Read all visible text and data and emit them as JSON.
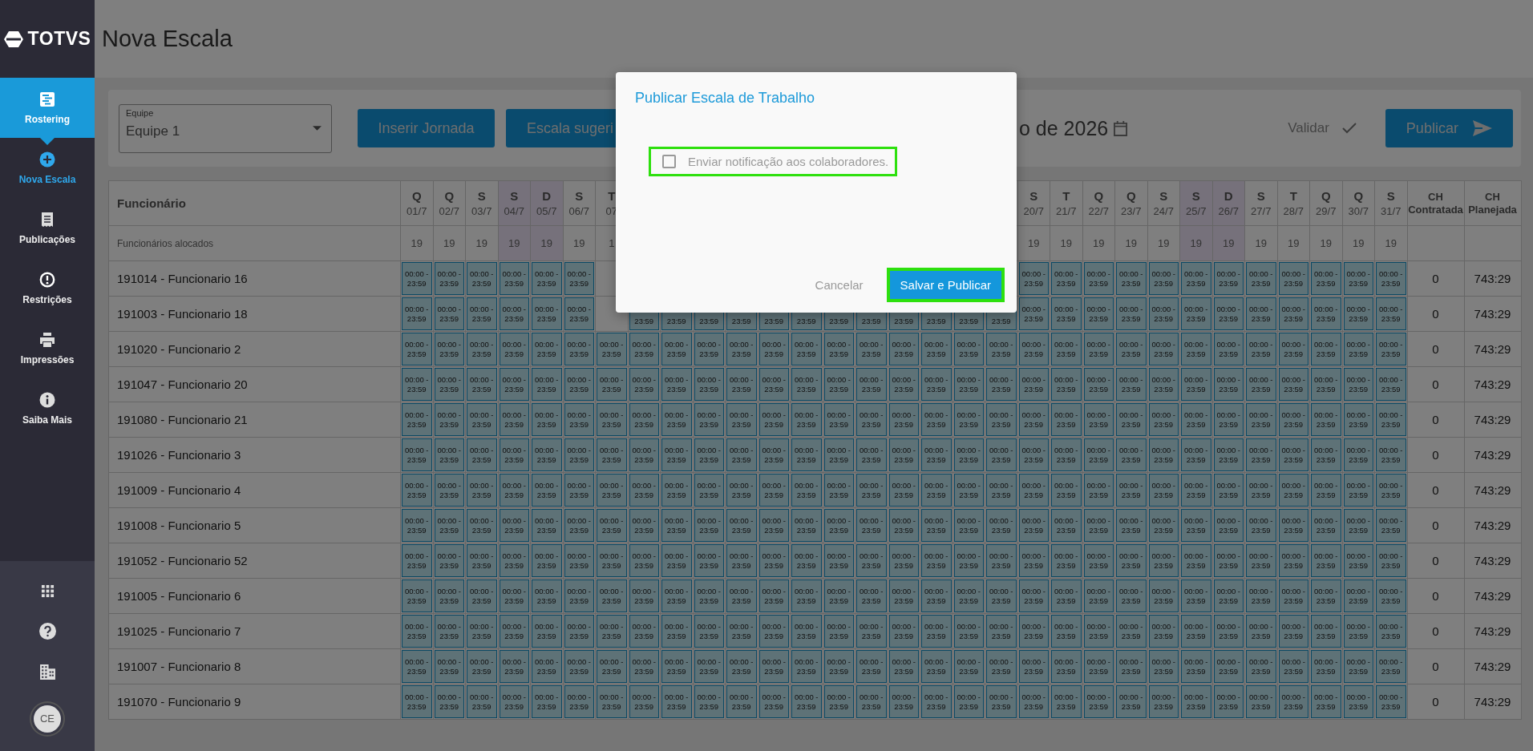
{
  "sidebar": {
    "logo": "TOTVS",
    "items": [
      {
        "label": "Rostering",
        "selected": true,
        "kind": "section"
      },
      {
        "label": "Nova Escala",
        "selected": false,
        "kind": "current"
      },
      {
        "label": "Publicações",
        "selected": false,
        "kind": "section"
      },
      {
        "label": "Restrições",
        "selected": false,
        "kind": "section"
      },
      {
        "label": "Impressões",
        "selected": false,
        "kind": "section"
      },
      {
        "label": "Saiba Mais",
        "selected": false,
        "kind": "section"
      }
    ],
    "avatar": "CE"
  },
  "page_title": "Nova Escala",
  "toolbar": {
    "team_select": {
      "label": "Equipe",
      "value": "Equipe 1"
    },
    "buttons": [
      "Inserir Jornada",
      "Escala sugeri"
    ],
    "month": "o de 2026",
    "validate": "Validar",
    "publish": "Publicar"
  },
  "table": {
    "name_header": "Funcionário",
    "allocated_label": "Funcionários alocados",
    "days": [
      {
        "day": "Q",
        "date": "01/7",
        "count": "19",
        "weekend": false
      },
      {
        "day": "Q",
        "date": "02/7",
        "count": "19",
        "weekend": false
      },
      {
        "day": "S",
        "date": "03/7",
        "count": "19",
        "weekend": false
      },
      {
        "day": "S",
        "date": "04/7",
        "count": "19",
        "weekend": true
      },
      {
        "day": "D",
        "date": "05/7",
        "count": "19",
        "weekend": true
      },
      {
        "day": "S",
        "date": "06/7",
        "count": "19",
        "weekend": false
      },
      {
        "day": "T",
        "date": "07",
        "count": "1",
        "weekend": false
      }
    ],
    "days_after": [
      {
        "day": "S",
        "date": "20/7",
        "count": "19",
        "weekend": false
      },
      {
        "day": "T",
        "date": "21/7",
        "count": "19",
        "weekend": false
      },
      {
        "day": "Q",
        "date": "22/7",
        "count": "19",
        "weekend": false
      },
      {
        "day": "Q",
        "date": "23/7",
        "count": "19",
        "weekend": false
      },
      {
        "day": "S",
        "date": "24/7",
        "count": "19",
        "weekend": false
      },
      {
        "day": "S",
        "date": "25/7",
        "count": "19",
        "weekend": true
      },
      {
        "day": "D",
        "date": "26/7",
        "count": "19",
        "weekend": true
      },
      {
        "day": "S",
        "date": "27/7",
        "count": "19",
        "weekend": false
      },
      {
        "day": "T",
        "date": "28/7",
        "count": "19",
        "weekend": false
      },
      {
        "day": "Q",
        "date": "29/7",
        "count": "19",
        "weekend": false
      },
      {
        "day": "Q",
        "date": "30/7",
        "count": "19",
        "weekend": false
      },
      {
        "day": "S",
        "date": "31/7",
        "count": "19",
        "weekend": false
      }
    ],
    "totals_headers": [
      "CH Contratada",
      "CH Planejada"
    ],
    "rows": [
      {
        "name": "191014 - Funcionario 16",
        "contracted": "0",
        "planned": "743:29",
        "cells": [
          "00:00 - 23:59",
          "00:00 - 23:59",
          "00:00 - 23:59",
          "00:00 - 23:59",
          "00:00 - 23:59",
          "00:00 - 23:59",
          null,
          null,
          null,
          null,
          null,
          null,
          null,
          null,
          null,
          null,
          null,
          null,
          null,
          "00:00 - 23:59",
          "00:00 - 23:59",
          "00:00 - 23:59",
          "00:00 - 23:59",
          "00:00 - 23:59",
          "00:00 - 23:59",
          "00:00 - 23:59",
          "00:00 - 23:59",
          "00:00 - 23:59",
          "00:00 - 23:59",
          "00:00 - 23:59",
          "00:00 - 23:59"
        ]
      },
      {
        "name": "191003 - Funcionario 18",
        "contracted": "0",
        "planned": "743:29",
        "cells": [
          "00:00 - 23:59",
          "00:00 - 23:59",
          "00:00 - 23:59",
          "00:00 - 23:59",
          "00:00 - 23:59",
          "00:00 - 23:59",
          null,
          "23:59",
          "23:59",
          "23:59",
          "23:59",
          "23:59",
          "23:59",
          "23:59",
          "23:59",
          "23:59",
          "23:59",
          "23:59",
          "23:59",
          "00:00 - 23:59",
          "00:00 - 23:59",
          "00:00 - 23:59",
          "00:00 - 23:59",
          "00:00 - 23:59",
          "00:00 - 23:59",
          "00:00 - 23:59",
          "00:00 - 23:59",
          "00:00 - 23:59",
          "00:00 - 23:59",
          "00:00 - 23:59",
          "00:00 - 23:59"
        ]
      },
      {
        "name": "191020 - Funcionario 2",
        "contracted": "0",
        "planned": "743:29",
        "cells": [
          "00:00 - 23:59",
          "00:00 - 23:59",
          "00:00 - 23:59",
          "00:00 - 23:59",
          "00:00 - 23:59",
          "00:00 - 23:59",
          "00:00 - 23:59",
          "00:00 - 23:59",
          "00:00 - 23:59",
          "00:00 - 23:59",
          "00:00 - 23:59",
          "00:00 - 23:59",
          "00:00 - 23:59",
          "00:00 - 23:59",
          "00:00 - 23:59",
          "00:00 - 23:59",
          "00:00 - 23:59",
          "00:00 - 23:59",
          "00:00 - 23:59",
          "00:00 - 23:59",
          "00:00 - 23:59",
          "00:00 - 23:59",
          "00:00 - 23:59",
          "00:00 - 23:59",
          "00:00 - 23:59",
          "00:00 - 23:59",
          "00:00 - 23:59",
          "00:00 - 23:59",
          "00:00 - 23:59",
          "00:00 - 23:59",
          "00:00 - 23:59"
        ]
      },
      {
        "name": "191047 - Funcionario 20",
        "contracted": "0",
        "planned": "743:29",
        "cells": [
          "00:00 - 23:59",
          "00:00 - 23:59",
          "00:00 - 23:59",
          "00:00 - 23:59",
          "00:00 - 23:59",
          "00:00 - 23:59",
          "00:00 - 23:59",
          "00:00 - 23:59",
          "00:00 - 23:59",
          "00:00 - 23:59",
          "00:00 - 23:59",
          "00:00 - 23:59",
          "00:00 - 23:59",
          "00:00 - 23:59",
          "00:00 - 23:59",
          "00:00 - 23:59",
          "00:00 - 23:59",
          "00:00 - 23:59",
          "00:00 - 23:59",
          "00:00 - 23:59",
          "00:00 - 23:59",
          "00:00 - 23:59",
          "00:00 - 23:59",
          "00:00 - 23:59",
          "00:00 - 23:59",
          "00:00 - 23:59",
          "00:00 - 23:59",
          "00:00 - 23:59",
          "00:00 - 23:59",
          "00:00 - 23:59",
          "00:00 - 23:59"
        ]
      },
      {
        "name": "191080 - Funcionario 21",
        "contracted": "0",
        "planned": "743:29",
        "cells": [
          "00:00 - 23:59",
          "00:00 - 23:59",
          "00:00 - 23:59",
          "00:00 - 23:59",
          "00:00 - 23:59",
          "00:00 - 23:59",
          "00:00 - 23:59",
          "00:00 - 23:59",
          "00:00 - 23:59",
          "00:00 - 23:59",
          "00:00 - 23:59",
          "00:00 - 23:59",
          "00:00 - 23:59",
          "00:00 - 23:59",
          "00:00 - 23:59",
          "00:00 - 23:59",
          "00:00 - 23:59",
          "00:00 - 23:59",
          "00:00 - 23:59",
          "00:00 - 23:59",
          "00:00 - 23:59",
          "00:00 - 23:59",
          "00:00 - 23:59",
          "00:00 - 23:59",
          "00:00 - 23:59",
          "00:00 - 23:59",
          "00:00 - 23:59",
          "00:00 - 23:59",
          "00:00 - 23:59",
          "00:00 - 23:59",
          "00:00 - 23:59"
        ]
      },
      {
        "name": "191026 - Funcionario 3",
        "contracted": "0",
        "planned": "743:29",
        "cells": [
          "00:00 - 23:59",
          "00:00 - 23:59",
          "00:00 - 23:59",
          "00:00 - 23:59",
          "00:00 - 23:59",
          "00:00 - 23:59",
          "00:00 - 23:59",
          "00:00 - 23:59",
          "00:00 - 23:59",
          "00:00 - 23:59",
          "00:00 - 23:59",
          "00:00 - 23:59",
          "00:00 - 23:59",
          "00:00 - 23:59",
          "00:00 - 23:59",
          "00:00 - 23:59",
          "00:00 - 23:59",
          "00:00 - 23:59",
          "00:00 - 23:59",
          "00:00 - 23:59",
          "00:00 - 23:59",
          "00:00 - 23:59",
          "00:00 - 23:59",
          "00:00 - 23:59",
          "00:00 - 23:59",
          "00:00 - 23:59",
          "00:00 - 23:59",
          "00:00 - 23:59",
          "00:00 - 23:59",
          "00:00 - 23:59",
          "00:00 - 23:59"
        ]
      },
      {
        "name": "191009 - Funcionario 4",
        "contracted": "0",
        "planned": "743:29",
        "cells": [
          "00:00 - 23:59",
          "00:00 - 23:59",
          "00:00 - 23:59",
          "00:00 - 23:59",
          "00:00 - 23:59",
          "00:00 - 23:59",
          "00:00 - 23:59",
          "00:00 - 23:59",
          "00:00 - 23:59",
          "00:00 - 23:59",
          "00:00 - 23:59",
          "00:00 - 23:59",
          "00:00 - 23:59",
          "00:00 - 23:59",
          "00:00 - 23:59",
          "00:00 - 23:59",
          "00:00 - 23:59",
          "00:00 - 23:59",
          "00:00 - 23:59",
          "00:00 - 23:59",
          "00:00 - 23:59",
          "00:00 - 23:59",
          "00:00 - 23:59",
          "00:00 - 23:59",
          "00:00 - 23:59",
          "00:00 - 23:59",
          "00:00 - 23:59",
          "00:00 - 23:59",
          "00:00 - 23:59",
          "00:00 - 23:59",
          "00:00 - 23:59"
        ]
      },
      {
        "name": "191008 - Funcionario 5",
        "contracted": "0",
        "planned": "743:29",
        "cells": [
          "00:00 - 23:59",
          "00:00 - 23:59",
          "00:00 - 23:59",
          "00:00 - 23:59",
          "00:00 - 23:59",
          "00:00 - 23:59",
          "00:00 - 23:59",
          "00:00 - 23:59",
          "00:00 - 23:59",
          "00:00 - 23:59",
          "00:00 - 23:59",
          "00:00 - 23:59",
          "00:00 - 23:59",
          "00:00 - 23:59",
          "00:00 - 23:59",
          "00:00 - 23:59",
          "00:00 - 23:59",
          "00:00 - 23:59",
          "00:00 - 23:59",
          "00:00 - 23:59",
          "00:00 - 23:59",
          "00:00 - 23:59",
          "00:00 - 23:59",
          "00:00 - 23:59",
          "00:00 - 23:59",
          "00:00 - 23:59",
          "00:00 - 23:59",
          "00:00 - 23:59",
          "00:00 - 23:59",
          "00:00 - 23:59",
          "00:00 - 23:59"
        ]
      },
      {
        "name": "191052 - Funcionario 52",
        "contracted": "0",
        "planned": "743:29",
        "cells": [
          "00:00 - 23:59",
          "00:00 - 23:59",
          "00:00 - 23:59",
          "00:00 - 23:59",
          "00:00 - 23:59",
          "00:00 - 23:59",
          "00:00 - 23:59",
          "00:00 - 23:59",
          "00:00 - 23:59",
          "00:00 - 23:59",
          "00:00 - 23:59",
          "00:00 - 23:59",
          "00:00 - 23:59",
          "00:00 - 23:59",
          "00:00 - 23:59",
          "00:00 - 23:59",
          "00:00 - 23:59",
          "00:00 - 23:59",
          "00:00 - 23:59",
          "00:00 - 23:59",
          "00:00 - 23:59",
          "00:00 - 23:59",
          "00:00 - 23:59",
          "00:00 - 23:59",
          "00:00 - 23:59",
          "00:00 - 23:59",
          "00:00 - 23:59",
          "00:00 - 23:59",
          "00:00 - 23:59",
          "00:00 - 23:59",
          "00:00 - 23:59"
        ]
      },
      {
        "name": "191005 - Funcionario 6",
        "contracted": "0",
        "planned": "743:29",
        "cells": [
          "00:00 - 23:59",
          "00:00 - 23:59",
          "00:00 - 23:59",
          "00:00 - 23:59",
          "00:00 - 23:59",
          "00:00 - 23:59",
          "00:00 - 23:59",
          "00:00 - 23:59",
          "00:00 - 23:59",
          "00:00 - 23:59",
          "00:00 - 23:59",
          "00:00 - 23:59",
          "00:00 - 23:59",
          "00:00 - 23:59",
          "00:00 - 23:59",
          "00:00 - 23:59",
          "00:00 - 23:59",
          "00:00 - 23:59",
          "00:00 - 23:59",
          "00:00 - 23:59",
          "00:00 - 23:59",
          "00:00 - 23:59",
          "00:00 - 23:59",
          "00:00 - 23:59",
          "00:00 - 23:59",
          "00:00 - 23:59",
          "00:00 - 23:59",
          "00:00 - 23:59",
          "00:00 - 23:59",
          "00:00 - 23:59",
          "00:00 - 23:59"
        ]
      },
      {
        "name": "191025 - Funcionario 7",
        "contracted": "0",
        "planned": "743:29",
        "cells": [
          "00:00 - 23:59",
          "00:00 - 23:59",
          "00:00 - 23:59",
          "00:00 - 23:59",
          "00:00 - 23:59",
          "00:00 - 23:59",
          "00:00 - 23:59",
          "00:00 - 23:59",
          "00:00 - 23:59",
          "00:00 - 23:59",
          "00:00 - 23:59",
          "00:00 - 23:59",
          "00:00 - 23:59",
          "00:00 - 23:59",
          "00:00 - 23:59",
          "00:00 - 23:59",
          "00:00 - 23:59",
          "00:00 - 23:59",
          "00:00 - 23:59",
          "00:00 - 23:59",
          "00:00 - 23:59",
          "00:00 - 23:59",
          "00:00 - 23:59",
          "00:00 - 23:59",
          "00:00 - 23:59",
          "00:00 - 23:59",
          "00:00 - 23:59",
          "00:00 - 23:59",
          "00:00 - 23:59",
          "00:00 - 23:59",
          "00:00 - 23:59"
        ]
      },
      {
        "name": "191007 - Funcionario 8",
        "contracted": "0",
        "planned": "743:29",
        "cells": [
          "00:00 - 23:59",
          "00:00 - 23:59",
          "00:00 - 23:59",
          "00:00 - 23:59",
          "00:00 - 23:59",
          "00:00 - 23:59",
          "00:00 - 23:59",
          "00:00 - 23:59",
          "00:00 - 23:59",
          "00:00 - 23:59",
          "00:00 - 23:59",
          "00:00 - 23:59",
          "00:00 - 23:59",
          "00:00 - 23:59",
          "00:00 - 23:59",
          "00:00 - 23:59",
          "00:00 - 23:59",
          "00:00 - 23:59",
          "00:00 - 23:59",
          "00:00 - 23:59",
          "00:00 - 23:59",
          "00:00 - 23:59",
          "00:00 - 23:59",
          "00:00 - 23:59",
          "00:00 - 23:59",
          "00:00 - 23:59",
          "00:00 - 23:59",
          "00:00 - 23:59",
          "00:00 - 23:59",
          "00:00 - 23:59",
          "00:00 - 23:59"
        ]
      },
      {
        "name": "191070 - Funcionario 9",
        "contracted": "0",
        "planned": "743:29",
        "cells": [
          "00:00 - 23:59",
          "00:00 - 23:59",
          "00:00 - 23:59",
          "00:00 - 23:59",
          "00:00 - 23:59",
          "00:00 - 23:59",
          "00:00 - 23:59",
          "00:00 - 23:59",
          "00:00 - 23:59",
          "00:00 - 23:59",
          "00:00 - 23:59",
          "00:00 - 23:59",
          "00:00 - 23:59",
          "00:00 - 23:59",
          "00:00 - 23:59",
          "00:00 - 23:59",
          "00:00 - 23:59",
          "00:00 - 23:59",
          "00:00 - 23:59",
          "00:00 - 23:59",
          "00:00 - 23:59",
          "00:00 - 23:59",
          "00:00 - 23:59",
          "00:00 - 23:59",
          "00:00 - 23:59",
          "00:00 - 23:59",
          "00:00 - 23:59",
          "00:00 - 23:59",
          "00:00 - 23:59",
          "00:00 - 23:59",
          "00:00 - 23:59"
        ]
      }
    ]
  },
  "dialog": {
    "title": "Publicar Escala de Trabalho",
    "checkbox": {
      "label": "Enviar notificação aos colaboradores.",
      "checked": false,
      "highlighted": true
    },
    "buttons": [
      {
        "label": "Cancelar",
        "kind": "text",
        "highlighted": false
      },
      {
        "label": "Salvar e Publicar",
        "kind": "primary",
        "highlighted": true
      }
    ]
  }
}
